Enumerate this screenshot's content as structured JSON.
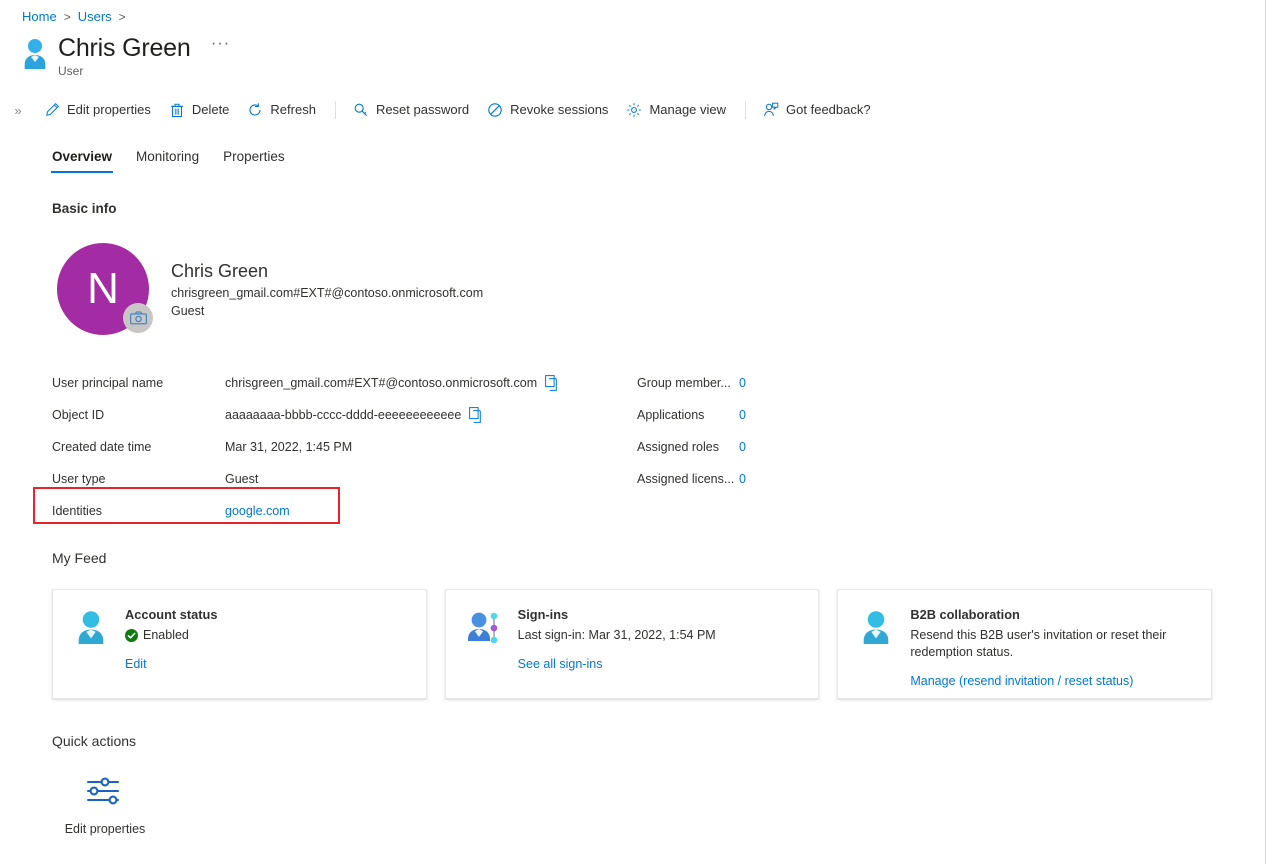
{
  "breadcrumb": {
    "items": [
      {
        "label": "Home",
        "sep": ">"
      },
      {
        "label": "Users",
        "sep": ">"
      }
    ]
  },
  "header": {
    "title": "Chris Green",
    "subtitle": "User",
    "more_label": "···",
    "person_icon": "person-icon"
  },
  "commandbar": {
    "expand_label": "»",
    "items": [
      {
        "label": "Edit properties",
        "icon": "pencil-icon"
      },
      {
        "label": "Delete",
        "icon": "trash-icon"
      },
      {
        "label": "Refresh",
        "icon": "refresh-icon"
      },
      {
        "label": "Reset password",
        "icon": "key-icon"
      },
      {
        "label": "Revoke sessions",
        "icon": "block-icon"
      },
      {
        "label": "Manage view",
        "icon": "gear-icon"
      },
      {
        "label": "Got feedback?",
        "icon": "feedback-icon"
      }
    ]
  },
  "tabs": [
    {
      "label": "Overview",
      "active": true
    },
    {
      "label": "Monitoring",
      "active": false
    },
    {
      "label": "Properties",
      "active": false
    }
  ],
  "sections": {
    "basic_info": "Basic info",
    "my_feed": "My Feed",
    "quick_actions": "Quick actions"
  },
  "identity": {
    "avatar_initial": "N",
    "avatar_color": "#a32ba3",
    "camera_icon": "camera-icon",
    "name": "Chris Green",
    "upn": "chrisgreen_gmail.com#EXT#@contoso.onmicrosoft.com",
    "user_type": "Guest"
  },
  "properties_left": [
    {
      "label": "User principal name",
      "value": "chrisgreen_gmail.com#EXT#@contoso.onmicrosoft.com",
      "copy": true,
      "link": false
    },
    {
      "label": "Object ID",
      "value": "aaaaaaaa-bbbb-cccc-dddd-eeeeeeeeeeee",
      "copy": true,
      "link": false
    },
    {
      "label": "Created date time",
      "value": "Mar 31, 2022, 1:45 PM",
      "copy": false,
      "link": false
    },
    {
      "label": "User type",
      "value": "Guest",
      "copy": false,
      "link": false
    },
    {
      "label": "Identities",
      "value": "google.com",
      "copy": false,
      "link": true
    }
  ],
  "properties_right": [
    {
      "label": "Group member...",
      "value": "0"
    },
    {
      "label": "Applications",
      "value": "0"
    },
    {
      "label": "Assigned roles",
      "value": "0"
    },
    {
      "label": "Assigned licens...",
      "value": "0"
    }
  ],
  "highlight": {
    "color": "#e8242a",
    "target": "Identities"
  },
  "feed_cards": [
    {
      "icon": "user-status-icon",
      "title": "Account status",
      "status_badge": "check-circle-icon",
      "status_text": "Enabled",
      "description": "",
      "link": "Edit"
    },
    {
      "icon": "sign-ins-icon",
      "title": "Sign-ins",
      "status_badge": "",
      "status_text": "",
      "description": "Last sign-in: Mar 31, 2022, 1:54 PM",
      "link": "See all sign-ins"
    },
    {
      "icon": "b2b-user-icon",
      "title": "B2B collaboration",
      "status_badge": "",
      "status_text": "",
      "description": "Resend this B2B user's invitation or reset their redemption status.",
      "link": "Manage (resend invitation / reset status)"
    }
  ],
  "quick_actions": [
    {
      "icon": "sliders-icon",
      "label": "Edit properties"
    }
  ],
  "colors": {
    "accent": "#0078d4",
    "text": "#323130",
    "muted": "#605e5c",
    "highlight_red": "#e8242a",
    "avatar_purple": "#a32ba3",
    "success_green": "#107c10"
  }
}
